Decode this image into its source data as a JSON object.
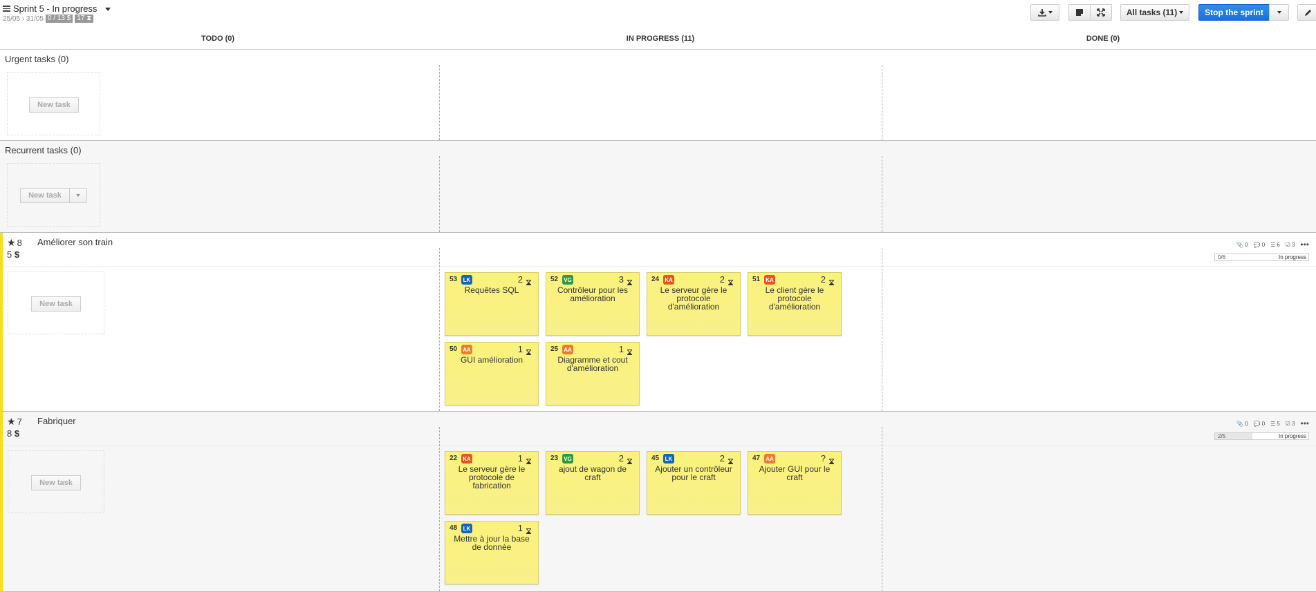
{
  "header": {
    "sprint_title": "Sprint 5 - In progress",
    "dates": "25/05 › 31/05",
    "points_pill": "0 / 13 $",
    "time_pill": "17 ⧗",
    "all_tasks_label": "All tasks (11)",
    "stop_label": "Stop the sprint"
  },
  "columns": {
    "todo": "TODO (0)",
    "in_progress": "IN PROGRESS (11)",
    "done": "DONE (0)"
  },
  "sections": {
    "urgent": "Urgent tasks (0)",
    "recurrent": "Recurrent tasks (0)",
    "new_task": "New task"
  },
  "stories": [
    {
      "rank": "8",
      "name": "Améliorer son train",
      "value": "5",
      "currency": "$",
      "attachments": "0",
      "comments": "0",
      "tasks_count": "6",
      "acceptance": "3",
      "progress_text": "0/6",
      "progress": 0,
      "state": "In progress",
      "cards": [
        {
          "id": "53",
          "user": "LK",
          "estimate": "2",
          "name": "Requêtes SQL"
        },
        {
          "id": "52",
          "user": "VG",
          "estimate": "3",
          "name": "Contrôleur pour les amélioration"
        },
        {
          "id": "24",
          "user": "KA",
          "estimate": "2",
          "name": "Le serveur gère le protocole d'amélioration"
        },
        {
          "id": "51",
          "user": "KA",
          "estimate": "2",
          "name": "Le client gère le protocole d'amélioration"
        },
        {
          "id": "50",
          "user": "AA",
          "estimate": "1",
          "name": "GUI amélioration"
        },
        {
          "id": "25",
          "user": "AA",
          "estimate": "1",
          "name": "Diagramme et cout d'amélioration"
        }
      ]
    },
    {
      "rank": "7",
      "name": "Fabriquer",
      "value": "8",
      "currency": "$",
      "attachments": "0",
      "comments": "0",
      "tasks_count": "5",
      "acceptance": "3",
      "progress_text": "2/5",
      "progress": 0.4,
      "state": "In progress",
      "cards": [
        {
          "id": "22",
          "user": "KA",
          "estimate": "1",
          "name": "Le serveur gère le protocole de fabrication"
        },
        {
          "id": "23",
          "user": "VG",
          "estimate": "2",
          "name": "ajout de wagon de craft"
        },
        {
          "id": "45",
          "user": "LK",
          "estimate": "2",
          "name": "Ajouter un contrôleur pour le craft"
        },
        {
          "id": "47",
          "user": "AA",
          "estimate": "?",
          "name": "Ajouter GUI pour le craft"
        },
        {
          "id": "48",
          "user": "LK",
          "estimate": "1",
          "name": "Mettre à jour la base de donnée"
        }
      ]
    }
  ],
  "colors": {
    "LK": "#1565c0",
    "VG": "#2e9a3a",
    "KA": "#e8541c",
    "AA": "#f07a2a",
    "primary": "#1f78e0",
    "story_marker": "#f4e01a"
  },
  "icons": {
    "export": "download-icon",
    "postit": "postit-view-icon",
    "fullscreen": "fullscreen-icon",
    "edit": "pencil-icon"
  }
}
